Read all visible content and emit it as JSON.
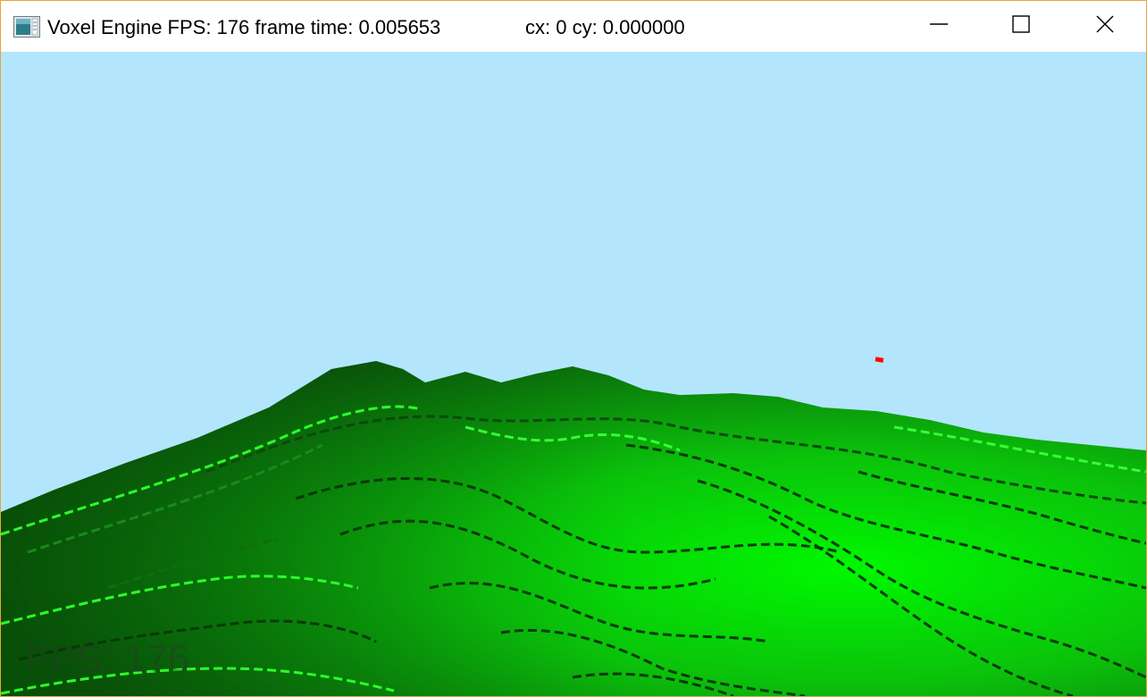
{
  "window": {
    "title": "Voxel Engine FPS: 176 frame time: 0.005653",
    "coords": "cx: 0 cy: 0.000000",
    "icon": "app-window-icon",
    "controls": {
      "minimize_icon": "minimize-icon",
      "maximize_icon": "maximize-icon",
      "close_icon": "close-icon"
    },
    "border_color": "#e8a33c"
  },
  "scene": {
    "sky_color": "#b3e5fc",
    "terrain_dark": "#0a5a0a",
    "terrain_light": "#00ff00",
    "marker_color": "#ff0000",
    "fps_overlay": "FPS: 176"
  }
}
